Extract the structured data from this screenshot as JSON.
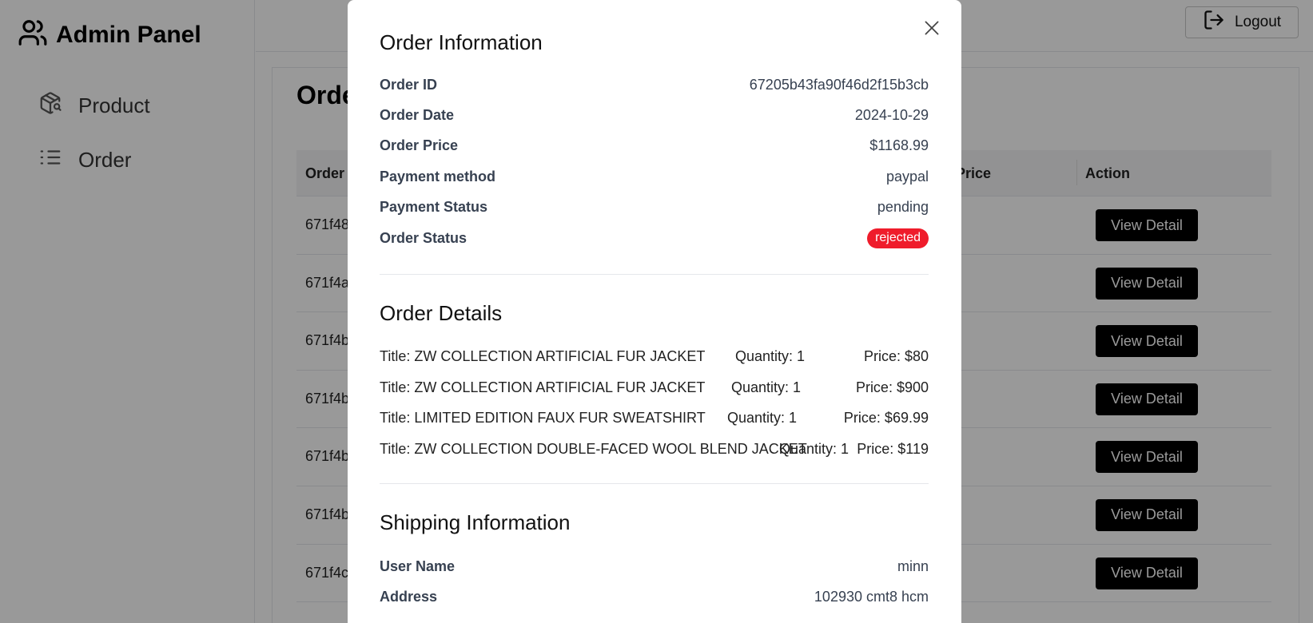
{
  "sidebar": {
    "brand": "Admin Panel",
    "items": [
      {
        "label": "Product",
        "icon": "package-search-icon"
      },
      {
        "label": "Order",
        "icon": "list-icon"
      }
    ]
  },
  "header": {
    "logout_label": "Logout"
  },
  "main": {
    "title": "Orde",
    "columns": [
      "Order",
      "er Price",
      "Action"
    ],
    "rows": [
      {
        "id": "671f48",
        "price": "$",
        "action": "View Detail"
      },
      {
        "id": "671f4a",
        "price": "$",
        "action": "View Detail"
      },
      {
        "id": "671f4b",
        "price": "$",
        "action": "View Detail"
      },
      {
        "id": "671f4b",
        "price": "$",
        "action": "View Detail"
      },
      {
        "id": "671f4b",
        "price": "$",
        "action": "View Detail"
      },
      {
        "id": "671f4b",
        "price": "$",
        "action": "View Detail"
      },
      {
        "id": "671f4c",
        "price": "$",
        "action": "View Detail"
      }
    ]
  },
  "modal": {
    "order_info": {
      "title": "Order Information",
      "fields": [
        {
          "label": "Order ID",
          "value": "67205b43fa90f46d2f15b3cb"
        },
        {
          "label": "Order Date",
          "value": "2024-10-29"
        },
        {
          "label": "Order Price",
          "value": "$1168.99"
        },
        {
          "label": "Payment method",
          "value": "paypal"
        },
        {
          "label": "Payment Status",
          "value": "pending"
        }
      ],
      "status_label": "Order Status",
      "status_value": "rejected",
      "status_color": "#ef1c2b"
    },
    "order_details": {
      "title": "Order Details",
      "items": [
        {
          "title": "Title: ZW COLLECTION ARTIFICIAL FUR JACKET",
          "quantity": "Quantity: 1",
          "price": "Price: $80"
        },
        {
          "title": "Title: ZW COLLECTION ARTIFICIAL FUR JACKET",
          "quantity": "Quantity: 1",
          "price": "Price: $900"
        },
        {
          "title": "Title: LIMITED EDITION FAUX FUR SWEATSHIRT",
          "quantity": "Quantity: 1",
          "price": "Price: $69.99"
        },
        {
          "title": "Title: ZW COLLECTION DOUBLE-FACED WOOL BLEND JACKET",
          "quantity": "Quantity: 1",
          "price": "Price: $119"
        }
      ]
    },
    "shipping": {
      "title": "Shipping Information",
      "fields": [
        {
          "label": "User Name",
          "value": "minn"
        },
        {
          "label": "Address",
          "value": "102930 cmt8 hcm"
        }
      ]
    }
  }
}
